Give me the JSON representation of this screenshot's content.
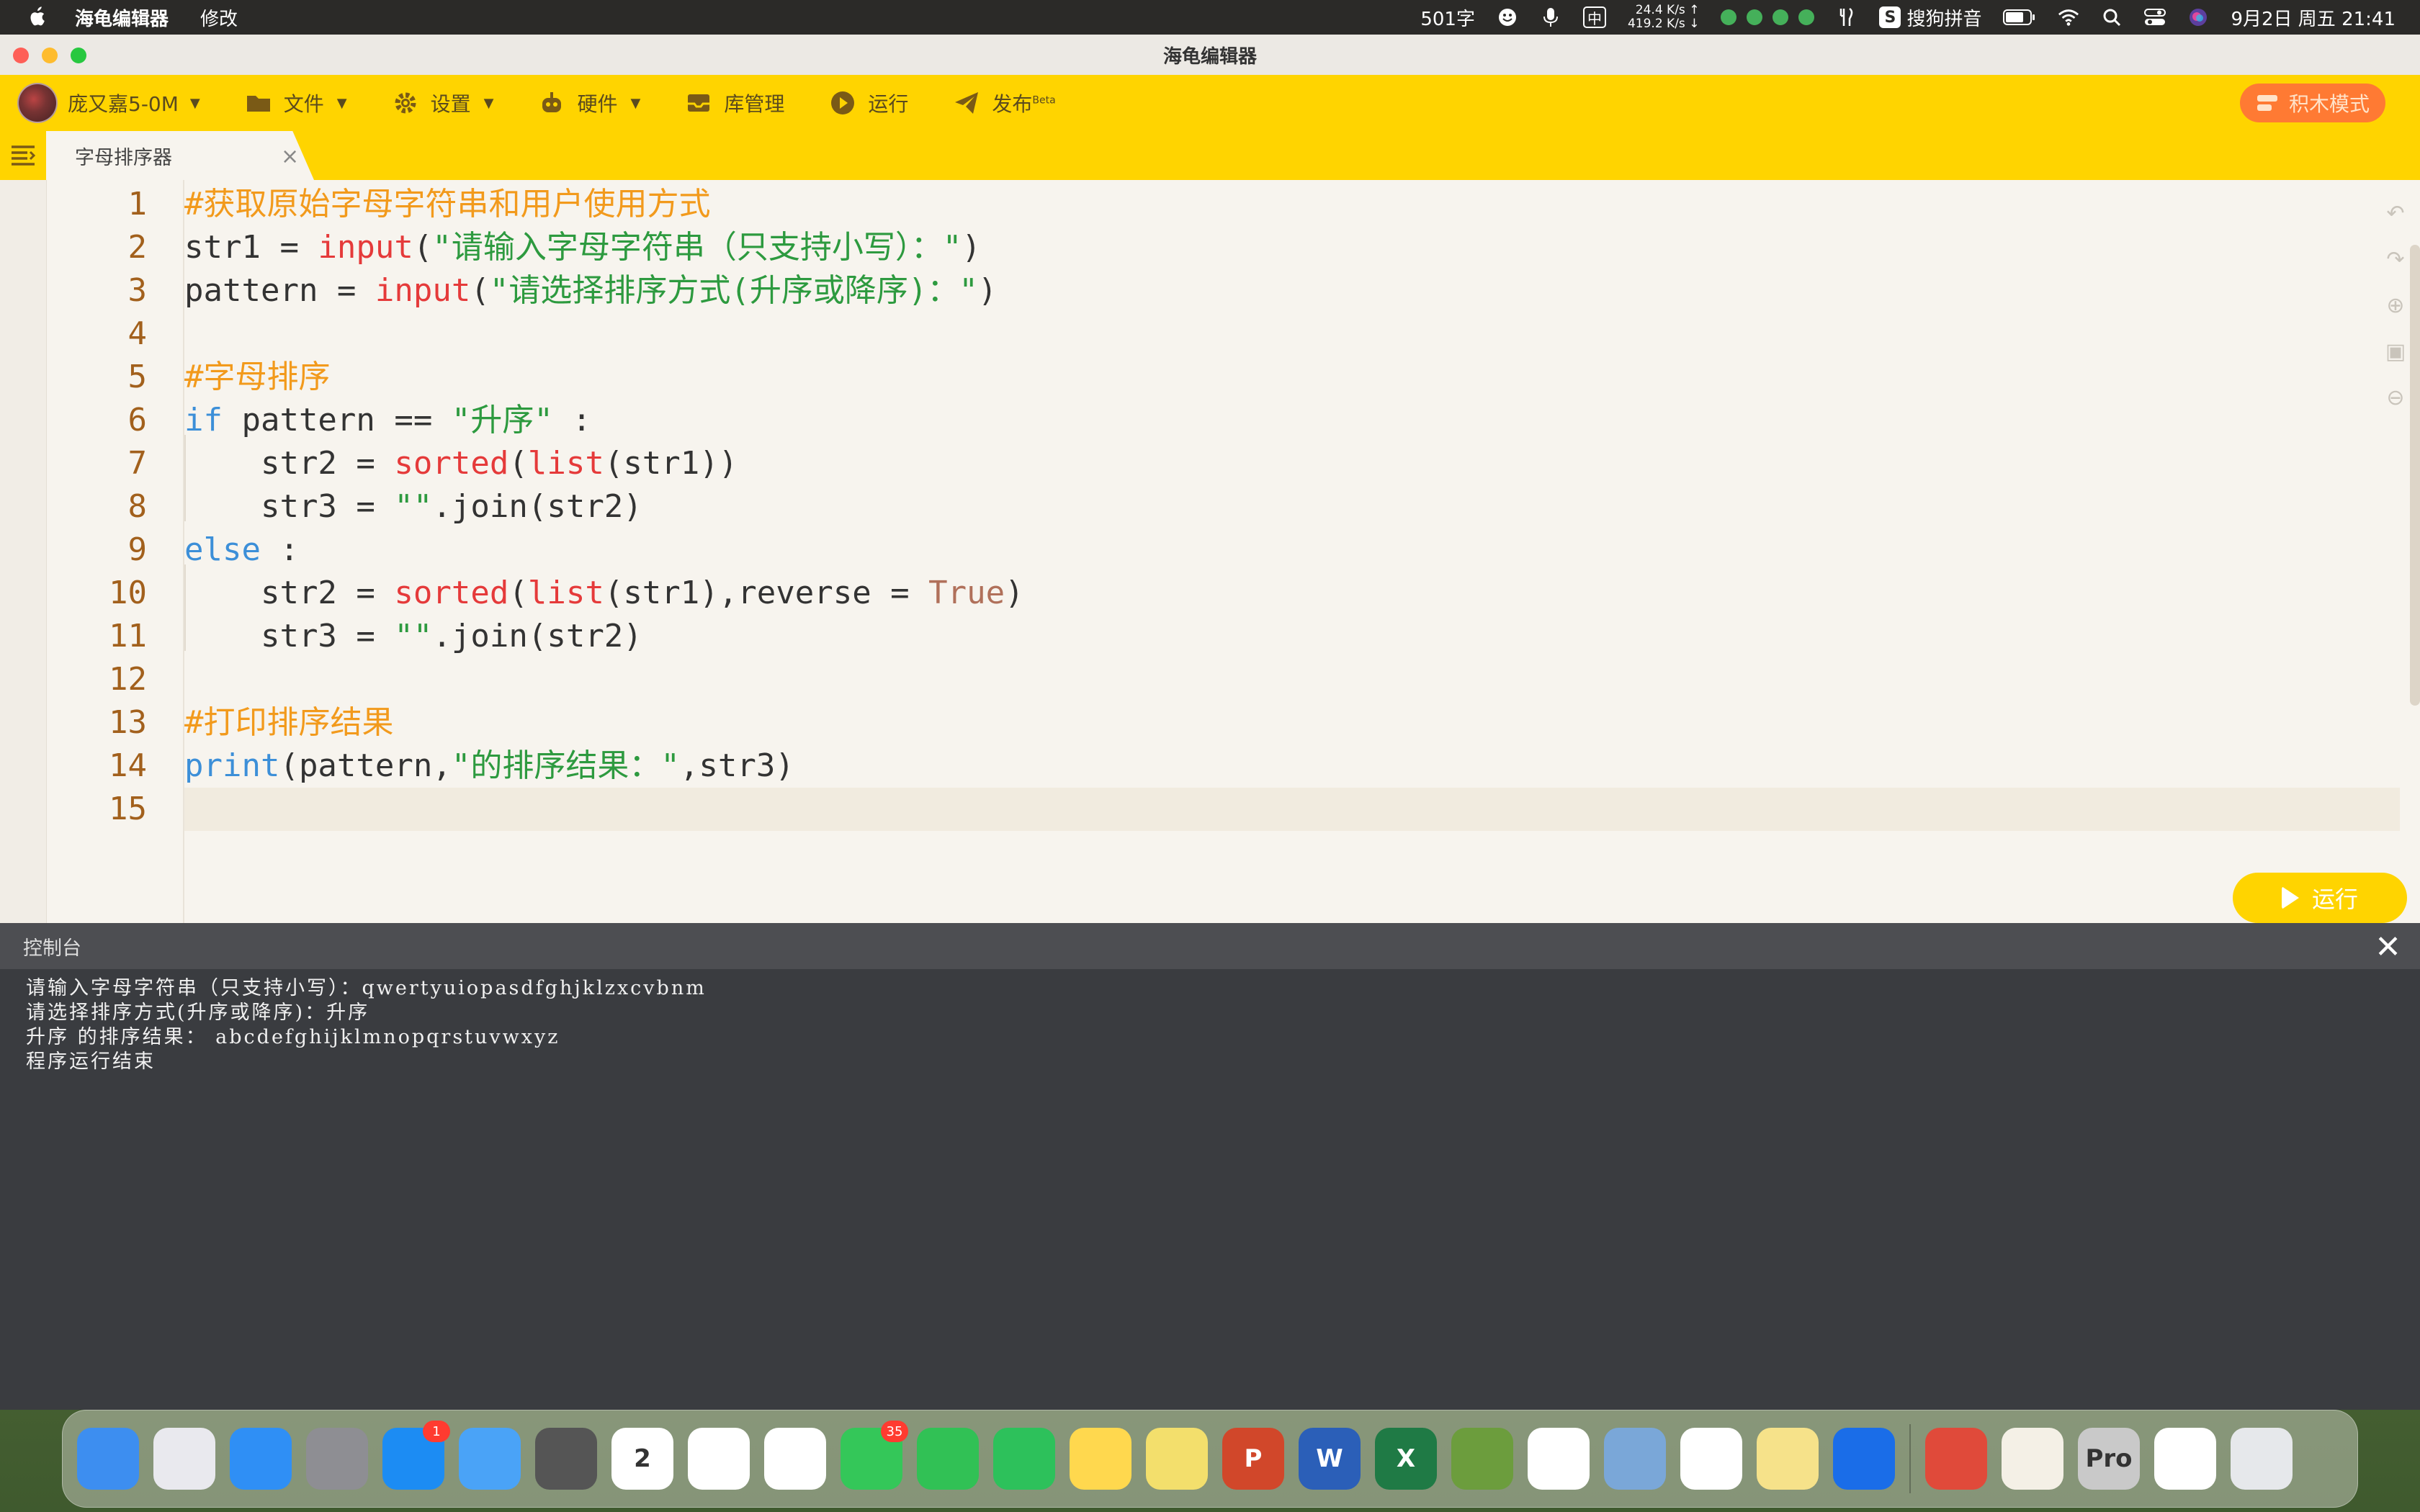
{
  "menubar": {
    "app_name": "海龟编辑器",
    "menu_edit": "修改",
    "word_count": "501字",
    "ime_label": "中",
    "net_up": "24.4 K/s ↑",
    "net_down": "419.2 K/s ↓",
    "sogou": "搜狗拼音",
    "datetime": "9月2日 周五  21:41"
  },
  "window": {
    "title": "海龟编辑器"
  },
  "toolbar": {
    "user": "庞又嘉5-0M",
    "file": "文件",
    "settings": "设置",
    "hardware": "硬件",
    "library": "库管理",
    "run": "运行",
    "publish": "发布",
    "publish_badge": "Beta",
    "block_mode": "积木模式"
  },
  "tab": {
    "label": "字母排序器",
    "close": "×"
  },
  "editor": {
    "line_numbers": [
      "1",
      "2",
      "3",
      "4",
      "5",
      "6",
      "7",
      "8",
      "9",
      "10",
      "11",
      "12",
      "13",
      "14",
      "15"
    ],
    "lines": [
      {
        "tokens": [
          {
            "c": "c-com",
            "t": "#获取原始字母字符串和用户使用方式"
          }
        ]
      },
      {
        "tokens": [
          {
            "c": "",
            "t": "str1 = "
          },
          {
            "c": "c-fn",
            "t": "input"
          },
          {
            "c": "",
            "t": "("
          },
          {
            "c": "c-str",
            "t": "\"请输入字母字符串（只支持小写）：\""
          },
          {
            "c": "",
            "t": ")"
          }
        ]
      },
      {
        "tokens": [
          {
            "c": "",
            "t": "pattern = "
          },
          {
            "c": "c-fn",
            "t": "input"
          },
          {
            "c": "",
            "t": "("
          },
          {
            "c": "c-str",
            "t": "\"请选择排序方式(升序或降序)：\""
          },
          {
            "c": "",
            "t": ")"
          }
        ]
      },
      {
        "tokens": []
      },
      {
        "tokens": [
          {
            "c": "c-com",
            "t": "#字母排序"
          }
        ]
      },
      {
        "tokens": [
          {
            "c": "c-kw",
            "t": "if"
          },
          {
            "c": "",
            "t": " pattern == "
          },
          {
            "c": "c-str",
            "t": "\"升序\""
          },
          {
            "c": "",
            "t": " :"
          }
        ]
      },
      {
        "tokens": [
          {
            "c": "",
            "t": "    str2 = "
          },
          {
            "c": "c-fn",
            "t": "sorted"
          },
          {
            "c": "",
            "t": "("
          },
          {
            "c": "c-fn",
            "t": "list"
          },
          {
            "c": "",
            "t": "(str1))"
          }
        ]
      },
      {
        "tokens": [
          {
            "c": "",
            "t": "    str3 = "
          },
          {
            "c": "c-str",
            "t": "\"\""
          },
          {
            "c": "",
            "t": ".join(str2)"
          }
        ]
      },
      {
        "tokens": [
          {
            "c": "c-kw",
            "t": "else"
          },
          {
            "c": "",
            "t": " :"
          }
        ]
      },
      {
        "tokens": [
          {
            "c": "",
            "t": "    str2 = "
          },
          {
            "c": "c-fn",
            "t": "sorted"
          },
          {
            "c": "",
            "t": "("
          },
          {
            "c": "c-fn",
            "t": "list"
          },
          {
            "c": "",
            "t": "(str1),reverse = "
          },
          {
            "c": "c-true",
            "t": "True"
          },
          {
            "c": "",
            "t": ")"
          }
        ]
      },
      {
        "tokens": [
          {
            "c": "",
            "t": "    str3 = "
          },
          {
            "c": "c-str",
            "t": "\"\""
          },
          {
            "c": "",
            "t": ".join(str2)"
          }
        ]
      },
      {
        "tokens": []
      },
      {
        "tokens": [
          {
            "c": "c-com",
            "t": "#打印排序结果"
          }
        ]
      },
      {
        "tokens": [
          {
            "c": "c-kw",
            "t": "print"
          },
          {
            "c": "",
            "t": "(pattern,"
          },
          {
            "c": "c-str",
            "t": "\"的排序结果：\""
          },
          {
            "c": "",
            "t": ",str3)"
          }
        ]
      },
      {
        "tokens": []
      }
    ],
    "run_button": "运行"
  },
  "console": {
    "title": "控制台",
    "close": "✕",
    "output": [
      "请输入字母字符串（只支持小写）：qwertyuiopasdfghjklzxcvbnm",
      "请选择排序方式(升序或降序)：升序",
      "升序 的排序结果： abcdefghijklmnopqrstuvwxyz",
      "程序运行结束"
    ]
  },
  "dock": {
    "apps": [
      {
        "name": "finder",
        "color": "#3d8ef0",
        "label": ""
      },
      {
        "name": "launchpad",
        "color": "#e9e9ee",
        "label": ""
      },
      {
        "name": "safari",
        "color": "#2f8ff5",
        "label": ""
      },
      {
        "name": "system-settings",
        "color": "#8e8e93",
        "label": ""
      },
      {
        "name": "app-store",
        "color": "#1c8cf3",
        "label": "",
        "badge": "1"
      },
      {
        "name": "mail",
        "color": "#4aa3f7",
        "label": ""
      },
      {
        "name": "calculator",
        "color": "#555",
        "label": ""
      },
      {
        "name": "calendar",
        "color": "#ffffff",
        "label": "2"
      },
      {
        "name": "reminders",
        "color": "#ffffff",
        "label": ""
      },
      {
        "name": "photos",
        "color": "#ffffff",
        "label": ""
      },
      {
        "name": "messages",
        "color": "#34c759",
        "label": "",
        "badge": "35"
      },
      {
        "name": "facetime",
        "color": "#31c155",
        "label": ""
      },
      {
        "name": "wechat",
        "color": "#2dc15b",
        "label": ""
      },
      {
        "name": "notes",
        "color": "#ffd84e",
        "label": ""
      },
      {
        "name": "stickies",
        "color": "#f3df6c",
        "label": ""
      },
      {
        "name": "powerpoint",
        "color": "#d1472a",
        "label": "P"
      },
      {
        "name": "word",
        "color": "#2b5fb8",
        "label": "W"
      },
      {
        "name": "excel",
        "color": "#1f7a45",
        "label": "X"
      },
      {
        "name": "minecraft",
        "color": "#6c9d3d",
        "label": ""
      },
      {
        "name": "chrome",
        "color": "#ffffff",
        "label": ""
      },
      {
        "name": "books-stack",
        "color": "#7aa7d8",
        "label": ""
      },
      {
        "name": "baidu-netdisk",
        "color": "#ffffff",
        "label": ""
      },
      {
        "name": "turtle-editor",
        "color": "#f6e28a",
        "label": ""
      },
      {
        "name": "feishu",
        "color": "#1a6de8",
        "label": ""
      }
    ],
    "apps_right": [
      {
        "name": "game-app",
        "color": "#e04a3a",
        "label": ""
      },
      {
        "name": "python-launcher",
        "color": "#f4f0e6",
        "label": ""
      },
      {
        "name": "instruments-pro",
        "color": "#c9c9c9",
        "label": "Pro"
      },
      {
        "name": "chrome-apps",
        "color": "#ffffff",
        "label": ""
      },
      {
        "name": "trash",
        "color": "#e6e8eb",
        "label": ""
      }
    ]
  }
}
